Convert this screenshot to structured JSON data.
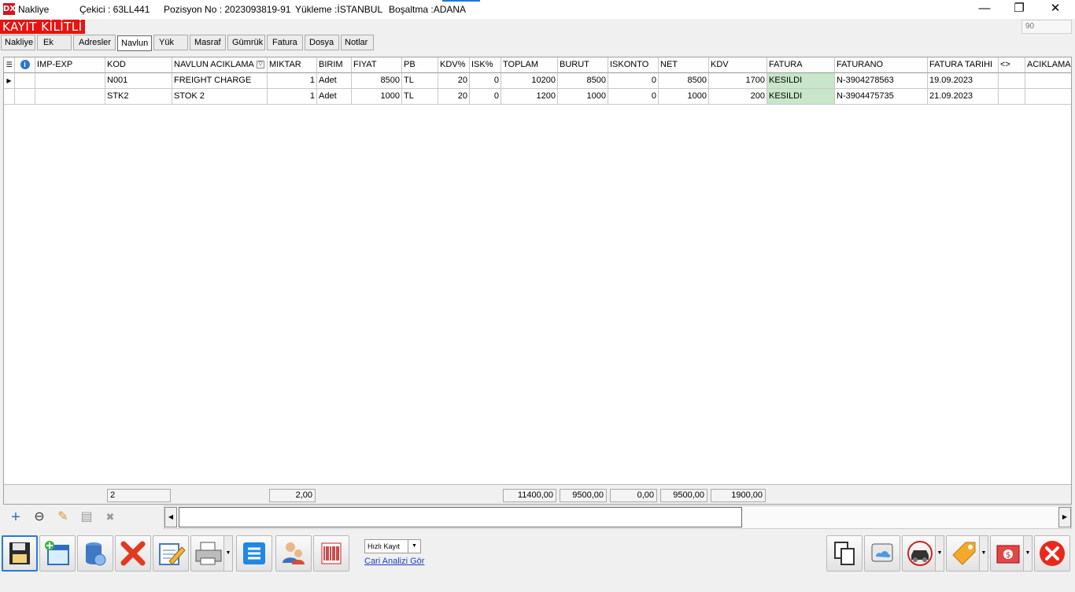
{
  "titlebar": {
    "app_icon": "DX",
    "app_name": "Nakliye",
    "cekici": "Çekici   : 63LL441",
    "pozisyon": "Pozisyon No : 2023093819-91",
    "yukleme": "Yükleme :İSTANBUL",
    "bosaltma": "Boşaltma :ADANA",
    "minimize": "—",
    "restore": "❐",
    "close": "✕"
  },
  "locked_banner": "KAYIT KİLİTLİ",
  "right_field_value": "90",
  "tabs": [
    {
      "label": "Nakliye"
    },
    {
      "label": "Ek"
    },
    {
      "label": "Adresler"
    },
    {
      "label": "Navlun",
      "active": true
    },
    {
      "label": "Yük"
    },
    {
      "label": "Masraf"
    },
    {
      "label": "Gümrük"
    },
    {
      "label": "Fatura"
    },
    {
      "label": "Dosya"
    },
    {
      "label": "Notlar"
    }
  ],
  "grid": {
    "columns": [
      "",
      "",
      "IMP-EXP",
      "KOD",
      "NAVLUN ACIKLAMA",
      "MIKTAR",
      "BIRIM",
      "FIYAT",
      "PB",
      "KDV%",
      "ISK%",
      "TOPLAM",
      "BURUT",
      "ISKONTO",
      "NET",
      "KDV",
      "FATURA",
      "FATURANO",
      "FATURA TARIHI",
      "<>",
      "ACIKLAMA"
    ],
    "rows": [
      {
        "imp_exp": "",
        "kod": "N001",
        "aciklama": "FREIGHT CHARGE",
        "miktar": "1",
        "birim": "Adet",
        "fiyat": "8500",
        "pb": "TL",
        "kdv_pct": "20",
        "isk_pct": "0",
        "toplam": "10200",
        "burut": "8500",
        "iskonto": "0",
        "net": "8500",
        "kdv": "1700",
        "fatura": "KESILDI",
        "faturano": "N-3904278563",
        "fatura_tarihi": "19.09.2023",
        "diff": "",
        "not": ""
      },
      {
        "imp_exp": "",
        "kod": "STK2",
        "aciklama": "STOK 2",
        "miktar": "1",
        "birim": "Adet",
        "fiyat": "1000",
        "pb": "TL",
        "kdv_pct": "20",
        "isk_pct": "0",
        "toplam": "1200",
        "burut": "1000",
        "iskonto": "0",
        "net": "1000",
        "kdv": "200",
        "fatura": "KESILDI",
        "faturano": "N-3904475735",
        "fatura_tarihi": "21.09.2023",
        "diff": "",
        "not": ""
      }
    ],
    "totals": {
      "count": "2",
      "miktar": "2,00",
      "toplam": "11400,00",
      "burut": "9500,00",
      "iskonto": "0,00",
      "net": "9500,00",
      "kdv": "1900,00"
    }
  },
  "navbar": {
    "add": "+",
    "remove": "⊖",
    "edit": "✎",
    "save": "▤",
    "cancel": "✖"
  },
  "bottom": {
    "quick_save_select": "Hızlı Kayıt",
    "cari_link": "Cari Analizi Gör"
  },
  "colors": {
    "locked": "#e8130f",
    "fatura_ok": "#c8e6c9",
    "accent": "#2a78d8"
  }
}
